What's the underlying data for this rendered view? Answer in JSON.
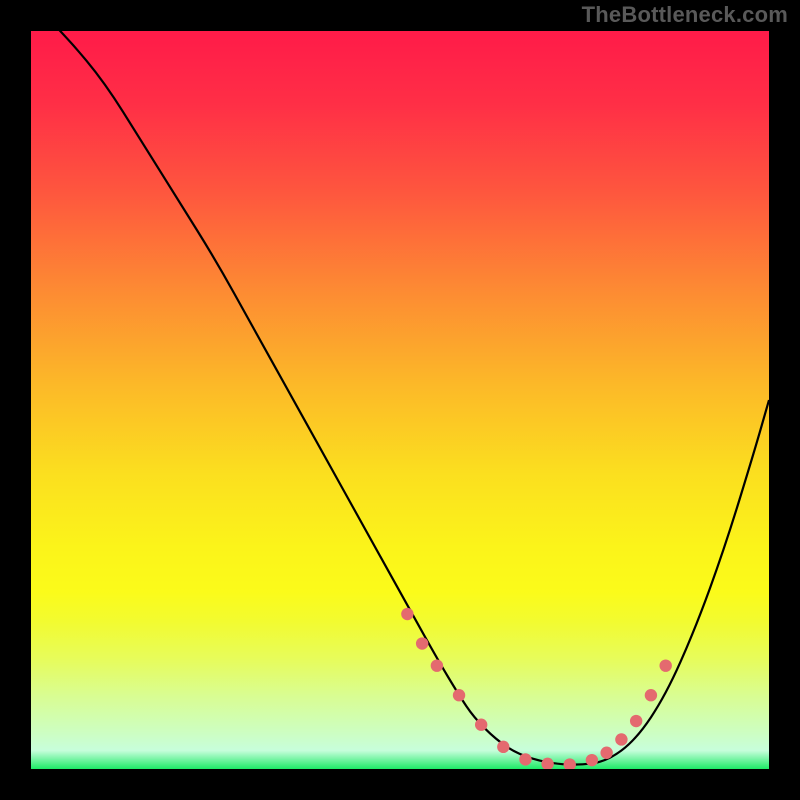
{
  "watermark": "TheBottleneck.com",
  "colors": {
    "frame": "#000000",
    "curve": "#000000",
    "dots": "#e46a6f",
    "gradient_stops": [
      {
        "offset": 0.0,
        "color": "#ff1b49"
      },
      {
        "offset": 0.1,
        "color": "#ff2f46"
      },
      {
        "offset": 0.22,
        "color": "#fe573e"
      },
      {
        "offset": 0.35,
        "color": "#fd8a33"
      },
      {
        "offset": 0.48,
        "color": "#fcb928"
      },
      {
        "offset": 0.6,
        "color": "#fbdf1f"
      },
      {
        "offset": 0.7,
        "color": "#fbf41a"
      },
      {
        "offset": 0.76,
        "color": "#fbfb1a"
      },
      {
        "offset": 0.8,
        "color": "#f2fb30"
      },
      {
        "offset": 0.85,
        "color": "#e7fc5a"
      },
      {
        "offset": 0.9,
        "color": "#d9fd91"
      },
      {
        "offset": 0.95,
        "color": "#cdfec1"
      },
      {
        "offset": 0.975,
        "color": "#c7fedb"
      },
      {
        "offset": 1.0,
        "color": "#1dea66"
      }
    ]
  },
  "chart_data": {
    "type": "line",
    "title": "",
    "xlabel": "",
    "ylabel": "",
    "x_range": [
      0,
      100
    ],
    "y_range": [
      0,
      100
    ],
    "series": [
      {
        "name": "bottleneck-curve",
        "x": [
          0,
          5,
          10,
          15,
          20,
          25,
          30,
          35,
          40,
          45,
          50,
          55,
          58,
          60,
          63,
          66,
          70,
          74,
          78,
          82,
          86,
          90,
          94,
          98,
          100
        ],
        "y": [
          104,
          99,
          93,
          85,
          77,
          69,
          60,
          51,
          42,
          33,
          24,
          15,
          10,
          7,
          4,
          2,
          0.8,
          0.5,
          1,
          4,
          10,
          19,
          30,
          43,
          50
        ]
      }
    ],
    "highlight_dots": {
      "name": "optimal-range-dots",
      "x": [
        51,
        53,
        55,
        58,
        61,
        64,
        67,
        70,
        73,
        76,
        78,
        80,
        82,
        84,
        86
      ],
      "y": [
        21,
        17,
        14,
        10,
        6,
        3,
        1.3,
        0.7,
        0.6,
        1.2,
        2.2,
        4,
        6.5,
        10,
        14
      ]
    }
  }
}
